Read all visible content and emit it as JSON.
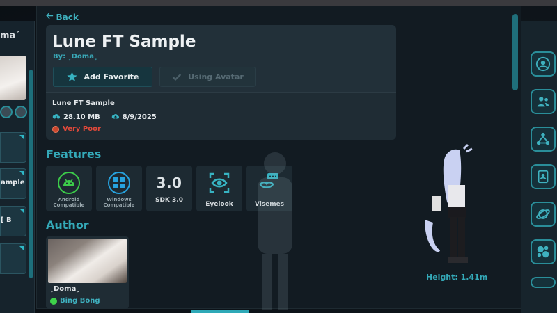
{
  "left_panel": {
    "title": "ma´",
    "card_texts": [
      "ample",
      "[ B"
    ]
  },
  "back": {
    "label": "Back"
  },
  "avatar": {
    "title": "Lune FT Sample",
    "author_by": "By: ¸Doma¸",
    "name": "Lune FT Sample",
    "size": "28.10 MB",
    "date": "8/9/2025",
    "performance": "Very Poor",
    "height": "Height: 1.41m"
  },
  "buttons": {
    "favorite": "Add Favorite",
    "using": "Using Avatar"
  },
  "features": {
    "title": "Features",
    "items": [
      {
        "icon": "android-icon",
        "label": "Android Compatible"
      },
      {
        "icon": "windows-icon",
        "label": "Windows Compatible"
      },
      {
        "icon": "sdk-version",
        "value": "3.0",
        "label": "SDK 3.0"
      },
      {
        "icon": "eyelook-icon",
        "label": "Eyelook"
      },
      {
        "icon": "visemes-icon",
        "label": "Visemes"
      }
    ]
  },
  "author": {
    "title": "Author",
    "name": "¸Doma¸",
    "status": "Bing Bong",
    "status_color": "#3ed34a"
  },
  "colors": {
    "accent": "#34a9b8",
    "performance": "#e2493a",
    "background": "#121b22"
  }
}
